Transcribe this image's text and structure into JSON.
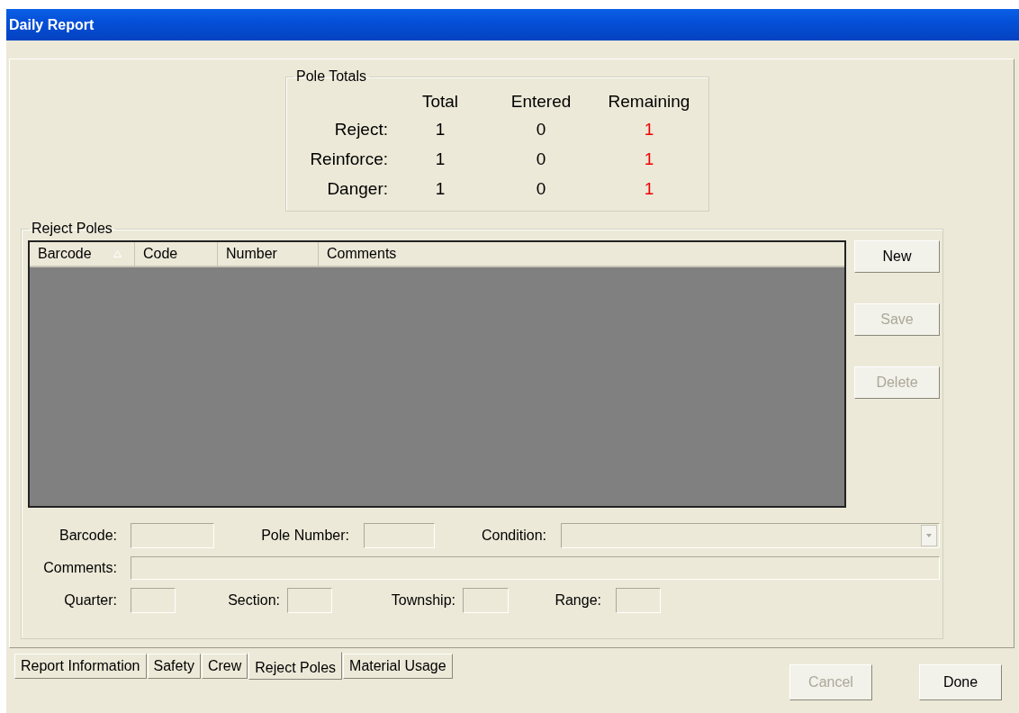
{
  "window": {
    "title": "Daily Report"
  },
  "pole_totals": {
    "title": "Pole Totals",
    "columns": [
      "Total",
      "Entered",
      "Remaining"
    ],
    "rows": [
      {
        "label": "Reject:",
        "total": "1",
        "entered": "0",
        "remaining": "1"
      },
      {
        "label": "Reinforce:",
        "total": "1",
        "entered": "0",
        "remaining": "1"
      },
      {
        "label": "Danger:",
        "total": "1",
        "entered": "0",
        "remaining": "1"
      }
    ]
  },
  "reject_poles": {
    "title": "Reject Poles",
    "list": {
      "columns": [
        {
          "label": "Barcode",
          "sorted": true
        },
        {
          "label": "Code",
          "sorted": false
        },
        {
          "label": "Number",
          "sorted": false
        },
        {
          "label": "Comments",
          "sorted": false
        }
      ]
    },
    "buttons": [
      {
        "label": "New",
        "disabled": false
      },
      {
        "label": "Save",
        "disabled": true
      },
      {
        "label": "Delete",
        "disabled": true
      }
    ],
    "fields": {
      "barcode": "Barcode:",
      "pole_number": "Pole Number:",
      "condition": "Condition:",
      "comments": "Comments:",
      "quarter": "Quarter:",
      "section": "Section:",
      "township": "Township:",
      "range": "Range:"
    }
  },
  "tabs": [
    {
      "label": "Report Information",
      "selected": false
    },
    {
      "label": "Safety",
      "selected": false
    },
    {
      "label": "Crew",
      "selected": false
    },
    {
      "label": "Reject Poles",
      "selected": true
    },
    {
      "label": "Material Usage",
      "selected": false
    }
  ],
  "footer_buttons": [
    {
      "label": "Cancel",
      "disabled": true
    },
    {
      "label": "Done",
      "disabled": false
    }
  ]
}
